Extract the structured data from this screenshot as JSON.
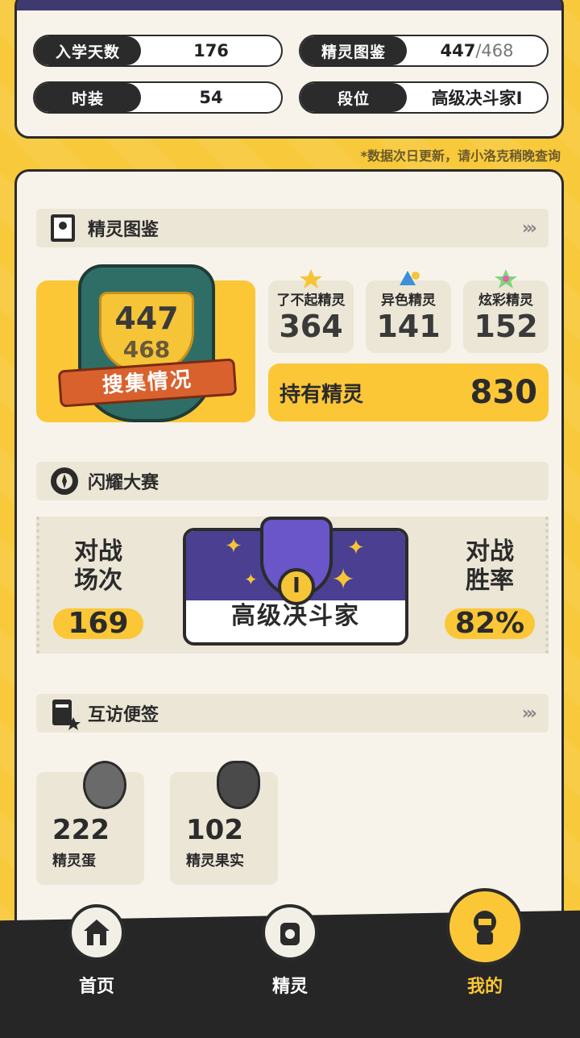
{
  "stats": {
    "school_days_label": "入学天数",
    "school_days_value": "176",
    "codex_label": "精灵图鉴",
    "codex_value": "447",
    "codex_total": "/468",
    "outfit_label": "时装",
    "outfit_value": "54",
    "rank_label": "段位",
    "rank_value": "高级决斗家I"
  },
  "note": "*数据次日更新，请小洛克稍晚查询",
  "codex_section": {
    "title": "精灵图鉴",
    "collected": "447",
    "total": "468",
    "ribbon": "搜集情况",
    "amazing_label": "了不起精灵",
    "amazing_value": "364",
    "shiny_label": "异色精灵",
    "shiny_value": "141",
    "dazzling_label": "炫彩精灵",
    "dazzling_value": "152",
    "owned_label": "持有精灵",
    "owned_value": "830"
  },
  "battle_section": {
    "title": "闪耀大赛",
    "battles_label_1": "对战",
    "battles_label_2": "场次",
    "battles_value": "169",
    "rank_name": "高级决斗家",
    "rank_tier": "I",
    "winrate_label_1": "对战",
    "winrate_label_2": "胜率",
    "winrate_value": "82%"
  },
  "visit_section": {
    "title": "互访便签",
    "egg_value": "222",
    "egg_label": "精灵蛋",
    "fruit_value": "102",
    "fruit_label": "精灵果实"
  },
  "nav": {
    "home": "首页",
    "pets": "精灵",
    "me": "我的"
  },
  "colors": {
    "accent_yellow": "#fbc737",
    "dark": "#2b2b2b",
    "card_bg": "#f7f3ea",
    "rank_purple": "#4a3f91"
  }
}
